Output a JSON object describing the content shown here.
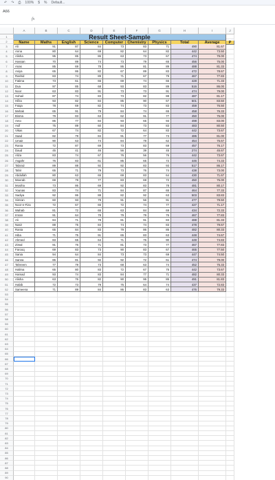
{
  "toolbar": {
    "zoom": "100%",
    "font": "Default..."
  },
  "formula_bar": {
    "name_box": "A66",
    "fx_label": "fx",
    "value": ""
  },
  "columns": [
    "A",
    "B",
    "C",
    "D",
    "E",
    "F",
    "G",
    "H",
    "I",
    "J"
  ],
  "sheet": {
    "title": "Result Sheet-Sample",
    "headers": [
      "Name",
      "Maths",
      "English",
      "Science",
      "Computer",
      "Chemistry",
      "Physics",
      "Total",
      "Average",
      "P"
    ],
    "rows": [
      [
        "Ali",
        "91",
        "87",
        "84",
        "73",
        "83",
        "71",
        "490",
        "81.67"
      ],
      [
        "Anna",
        "80",
        "64",
        "69",
        "82",
        "64",
        "82",
        "442",
        "73.50"
      ],
      [
        "Alisha",
        "95",
        "85",
        "86",
        "63",
        "73",
        "67",
        "474",
        "79.00"
      ],
      [
        "Hassan",
        "70",
        "89",
        "74",
        "73",
        "79",
        "65",
        "456",
        "75.00"
      ],
      [
        "Anas",
        "85",
        "69",
        "78",
        "86",
        "81",
        "89",
        "488",
        "81.33"
      ],
      [
        "Asiya",
        "65",
        "86",
        "82",
        "67",
        "89",
        "83",
        "472",
        "78.67"
      ],
      [
        "Rashid",
        "83",
        "74",
        "89",
        "71",
        "67",
        "79",
        "467",
        "77.83"
      ],
      [
        "Fatima",
        "73",
        "61",
        "65",
        "69",
        "74",
        "66",
        "428",
        "71.33"
      ],
      [
        "Dua",
        "97",
        "85",
        "68",
        "93",
        "83",
        "89",
        "516",
        "86.00"
      ],
      [
        "Noor",
        "63",
        "83",
        "91",
        "73",
        "73",
        "91",
        "474",
        "79.00"
      ],
      [
        "Sohail",
        "87",
        "74",
        "83",
        "73",
        "82",
        "88",
        "487",
        "81.17"
      ],
      [
        "Hifza",
        "93",
        "82",
        "84",
        "85",
        "90",
        "67",
        "501",
        "83.50"
      ],
      [
        "Faiqa",
        "78",
        "69",
        "82",
        "74",
        "73",
        "83",
        "459",
        "76.50"
      ],
      [
        "Mehak",
        "65",
        "91",
        "79",
        "84",
        "74",
        "65",
        "458",
        "76.33"
      ],
      [
        "Bisma",
        "79",
        "83",
        "63",
        "62",
        "91",
        "77",
        "450",
        "75.00"
      ],
      [
        "Amo",
        "86",
        "77",
        "84",
        "93",
        "65",
        "93",
        "498",
        "83.00"
      ],
      [
        "Asif",
        "75",
        "89",
        "60",
        "84",
        "73",
        "83",
        "483",
        "80.50"
      ],
      [
        "Vikas",
        "67",
        "74",
        "82",
        "72",
        "64",
        "83",
        "442",
        "73.67"
      ],
      [
        "Saad",
        "82",
        "79",
        "84",
        "91",
        "77",
        "73",
        "486",
        "81.00"
      ],
      [
        "Umair",
        "90",
        "63",
        "74",
        "84",
        "79",
        "62",
        "454",
        "75.67"
      ],
      [
        "Rania",
        "72",
        "87",
        "69",
        "73",
        "83",
        "69",
        "457",
        "76.17"
      ],
      [
        "Daud",
        "45",
        "41",
        "46",
        "56",
        "39",
        "45",
        "274",
        "45.67"
      ],
      [
        "Aliza",
        "83",
        "74",
        "67",
        "76",
        "56",
        "76",
        "442",
        "73.67"
      ],
      [
        "Asgahr",
        "76",
        "83",
        "61",
        "85",
        "65",
        "72",
        "446",
        "74.33"
      ],
      [
        "Tabraiz",
        "89",
        "88",
        "92",
        "92",
        "83",
        "93",
        "517",
        "86.17"
      ],
      [
        "Tahir",
        "65",
        "71",
        "79",
        "73",
        "76",
        "74",
        "438",
        "73.00"
      ],
      [
        "Abdullah",
        "80",
        "63",
        "65",
        "69",
        "83",
        "64",
        "430",
        "71.67"
      ],
      [
        "Meerab",
        "69",
        "79",
        "77",
        "83",
        "69",
        "72",
        "450",
        "75.00"
      ],
      [
        "Mosiha",
        "73",
        "86",
        "69",
        "92",
        "83",
        "78",
        "481",
        "80.17"
      ],
      [
        "Younas",
        "83",
        "74",
        "71",
        "84",
        "87",
        "65",
        "464",
        "77.33"
      ],
      [
        "Sadiya",
        "92",
        "86",
        "88",
        "82",
        "92",
        "63",
        "503",
        "83.83"
      ],
      [
        "Simran",
        "60",
        "93",
        "79",
        "91",
        "56",
        "91",
        "477",
        "79.50"
      ],
      [
        "Noor-e-Fiza",
        "72",
        "67",
        "65",
        "72",
        "74",
        "77",
        "427",
        "71.17"
      ],
      [
        "Wahab",
        "81",
        "72",
        "65",
        "63",
        "84",
        "69",
        "434",
        "72.33"
      ],
      [
        "Imran",
        "91",
        "64",
        "78",
        "79",
        "79",
        "76",
        "467",
        "77.83"
      ],
      [
        "Ali",
        "84",
        "71",
        "78",
        "81",
        "91",
        "83",
        "488",
        "81.33"
      ],
      [
        "Nasir",
        "88",
        "75",
        "84",
        "74",
        "74",
        "83",
        "478",
        "79.67"
      ],
      [
        "Rania",
        "65",
        "84",
        "83",
        "79",
        "86",
        "85",
        "482",
        "80.33"
      ],
      [
        "Hiba",
        "71",
        "75",
        "91",
        "65",
        "83",
        "63",
        "448",
        "74.67"
      ],
      [
        "Ahmed",
        "83",
        "65",
        "64",
        "71",
        "76",
        "90",
        "449",
        "74.83"
      ],
      [
        "Zimal",
        "91",
        "76",
        "71",
        "81",
        "73",
        "77",
        "467",
        "77.83"
      ],
      [
        "Farooq",
        "69",
        "83",
        "73",
        "90",
        "83",
        "67",
        "465",
        "77.50"
      ],
      [
        "Sania",
        "94",
        "64",
        "84",
        "73",
        "73",
        "69",
        "447",
        "74.50"
      ],
      [
        "Sanna",
        "86",
        "81",
        "92",
        "92",
        "72",
        "61",
        "474",
        "79.00"
      ],
      [
        "Tahreem",
        "77",
        "79",
        "73",
        "68",
        "63",
        "74",
        "452",
        "75.33"
      ],
      [
        "Halima",
        "65",
        "80",
        "83",
        "72",
        "67",
        "75",
        "442",
        "73.67"
      ],
      [
        "Hamad",
        "93",
        "74",
        "83",
        "84",
        "77",
        "71",
        "482",
        "80.33"
      ],
      [
        "Alisha",
        "63",
        "76",
        "82",
        "90",
        "95",
        "85",
        "491",
        "81.83"
      ],
      [
        "Habib",
        "72",
        "73",
        "79",
        "75",
        "64",
        "74",
        "437",
        "72.83"
      ],
      [
        "Sameena",
        "71",
        "89",
        "84",
        "86",
        "83",
        "63",
        "476",
        "79.33"
      ]
    ]
  }
}
